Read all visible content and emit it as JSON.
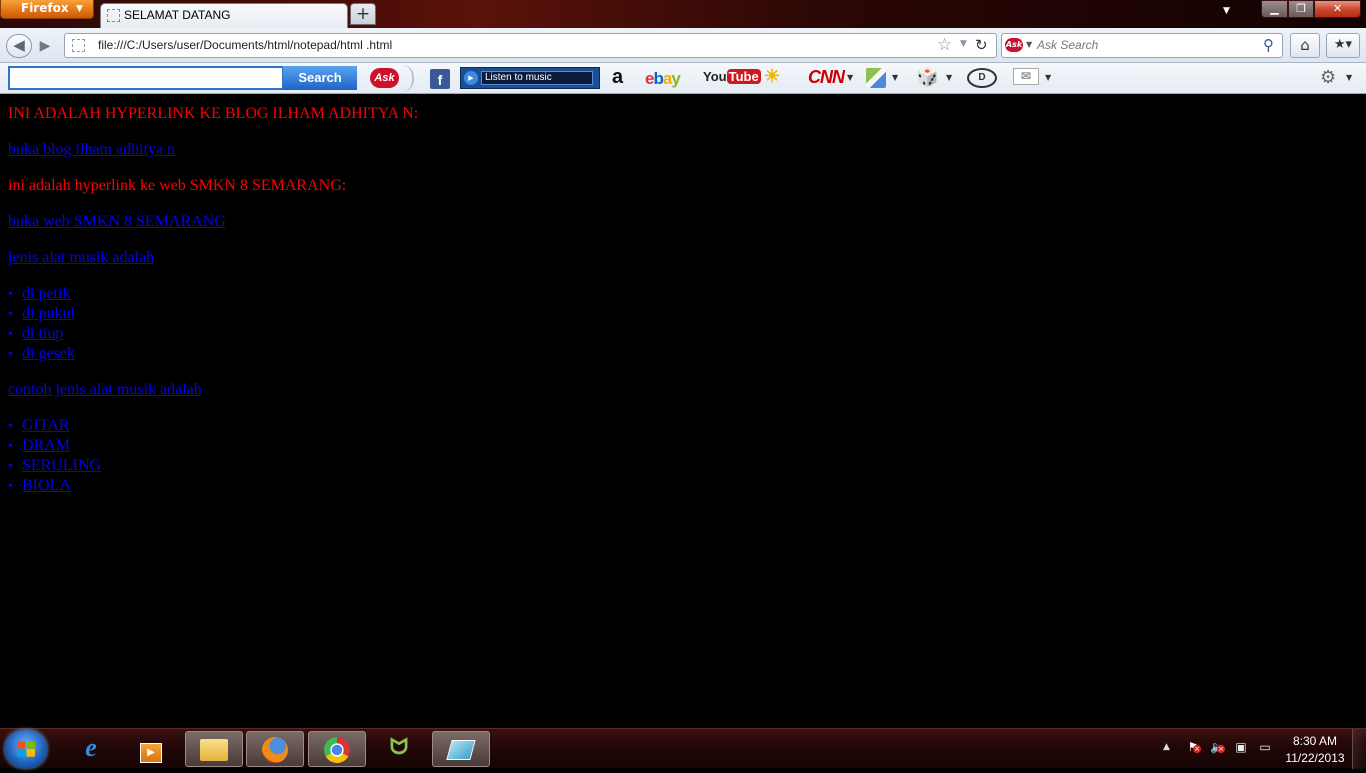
{
  "browser": {
    "menu_label": "Firefox",
    "tab_title": "SELAMAT DATANG",
    "new_tab_label": "+",
    "url": "file:///C:/Users/user/Documents/html/notepad/html .html",
    "search_placeholder": "Ask Search"
  },
  "ask_toolbar": {
    "search_value": "",
    "search_button": "Search",
    "logo": "Ask",
    "music_label": "Listen to music",
    "icons": [
      "facebook-icon",
      "amazon-icon",
      "ebay-icon",
      "youtube-icon",
      "weather-icon",
      "cnn-icon",
      "maps-icon",
      "games-icon",
      "dictionary-icon",
      "mail-icon",
      "settings-icon"
    ],
    "amazon": "a",
    "ebay": {
      "e": "e",
      "b": "b",
      "a": "a",
      "y": "y"
    },
    "youtube": {
      "you": "You",
      "tube": "Tube"
    },
    "cnn": "CNN",
    "facebook": "f"
  },
  "page": {
    "heading1": "INI ADALAH HYPERLINK KE BLOG ILHAM ADHITYA N:",
    "link1": "buka blog ilham adhitya n",
    "heading2": "ini adalah hyperlink ke web SMKN 8 SEMARANG:",
    "link2": "buka web SMKN 8 SEMARANG",
    "list1_title": "jenis alat musik adalah",
    "list1": [
      "di petik",
      "di pukul",
      "di tiup",
      "di gesek"
    ],
    "list2_title": "contoh jenis alat musik adalah",
    "list2": [
      "GITAR",
      "DRAM",
      "SERULING",
      "BIOLA"
    ]
  },
  "taskbar": {
    "clock_time": "8:30 AM",
    "clock_date": "11/22/2013",
    "apps": [
      "internet-explorer",
      "media-player",
      "windows-explorer",
      "firefox",
      "chrome",
      "app-green",
      "app-blue"
    ],
    "active_app": "firefox"
  },
  "colors": {
    "page_bg": "#000000",
    "red_text": "#ff0000",
    "link": "#0000ff"
  }
}
